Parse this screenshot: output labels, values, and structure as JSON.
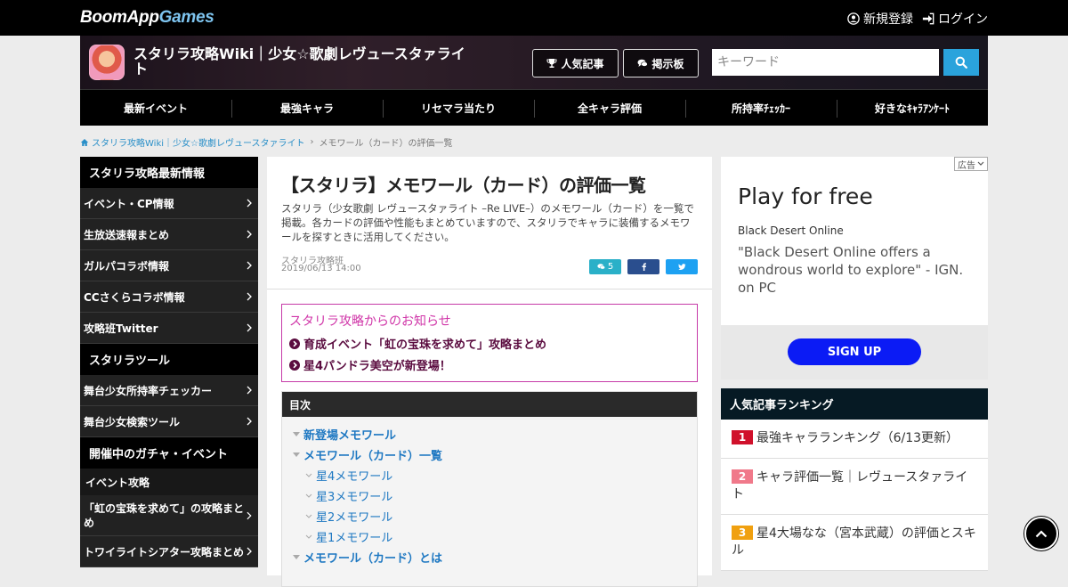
{
  "topbar": {
    "logo_part1": "BoomApp",
    "logo_part2": "Games",
    "register": "新規登録",
    "login": "ログイン"
  },
  "header": {
    "site_title": "スタリラ攻略Wiki｜少女☆歌劇レヴュースタァライト",
    "popular_button": "人気記事",
    "board_button": "掲示板",
    "search_placeholder": "キーワード"
  },
  "nav": {
    "items": [
      "最新イベント",
      "最強キャラ",
      "リセマラ当たり",
      "全キャラ評価",
      "所持率ﾁｪｯｶｰ",
      "好きなｷｬﾗｱﾝｹｰﾄ"
    ]
  },
  "breadcrumb": {
    "home": "スタリラ攻略Wiki｜少女☆歌劇レヴュースタァライト",
    "separator": "›",
    "current": "メモワール（カード）の評価一覧"
  },
  "sidebar": {
    "section1_title": "スタリラ攻略最新情報",
    "section1_items": [
      "イベント・CP情報",
      "生放送速報まとめ",
      "ガルパコラボ情報",
      "CCさくらコラボ情報",
      "攻略班Twitter"
    ],
    "section2_title": "スタリラツール",
    "section2_items": [
      "舞台少女所持率チェッカー",
      "舞台少女検索ツール"
    ],
    "section3_title": "開催中のガチャ・イベント",
    "section3_sub": "イベント攻略",
    "section3_items": [
      "「虹の宝珠を求めて」の攻略まとめ",
      "トワイライトシアター攻略まとめ"
    ]
  },
  "article": {
    "title": "【スタリラ】メモワール（カード）の評価一覧",
    "description": "スタリラ（少女歌劇 レヴュースタァライト –Re LIVE–）のメモワール（カード）を一覧で掲載。各カードの評価や性能もまとめていますので、スタリラでキャラに装備するメモワールを探すときに活用してください。",
    "author": "スタリラ攻略班",
    "date": "2019/06/13 14:00",
    "comment_count": "5",
    "notice_title": "スタリラ攻略からのお知らせ",
    "notice_items": [
      "育成イベント「虹の宝珠を求めて」攻略まとめ",
      "星4パンドラ美空が新登場！"
    ],
    "toc_title": "目次",
    "toc_items": [
      "新登場メモワール",
      "メモワール（カード）一覧",
      "星4メモワール",
      "星3メモワール",
      "星2メモワール",
      "星1メモワール",
      "メモワール（カード）とは"
    ]
  },
  "ad": {
    "badge": "広告",
    "title": "Play for free",
    "brand": "Black Desert Online",
    "quote": "\"Black Desert Online offers a wondrous world to explore\" - IGN. on PC",
    "cta": "SIGN UP"
  },
  "ranking": {
    "title": "人気記事ランキング",
    "items": [
      {
        "rank": "1",
        "text": "最強キャラランキング（6/13更新）",
        "color": "#d0112b"
      },
      {
        "rank": "2",
        "text": "キャラ評価一覧｜レヴュースタァライト",
        "color": "#f0798a"
      },
      {
        "rank": "3",
        "text": "星4大場なな（宮本武蔵）の評価とスキル",
        "color": "#f0a010"
      }
    ]
  },
  "colors": {
    "accent": "#2aa3dc",
    "notice": "#c63aa8"
  }
}
